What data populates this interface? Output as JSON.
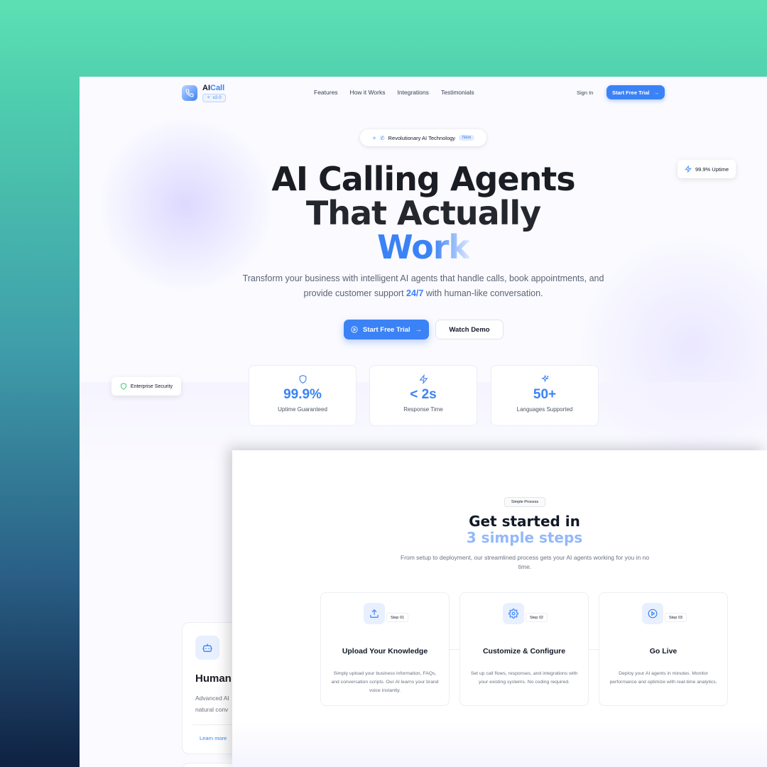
{
  "colors": {
    "accent": "#3b82f6",
    "bg_top": "#5ce0b3",
    "bg_bottom": "#0f2142",
    "text": "#111827"
  },
  "nav": {
    "brand_ai": "AI",
    "brand_call": "Call",
    "version": "v2.0",
    "links": [
      "Features",
      "How it Works",
      "Integrations",
      "Testimonials"
    ],
    "sign_in": "Sign In",
    "cta": "Start Free Trial"
  },
  "hero": {
    "pill_text": "Revolutionary AI Technology",
    "pill_badge": "New",
    "uptime_chip": "99.9% Uptime",
    "title_line1": "AI Calling Agents",
    "title_line2": "That Actually",
    "title_line3": "Work",
    "subtitle_before": "Transform your business with intelligent AI agents that handle calls, book appointments, and provide customer support ",
    "subtitle_highlight": "24/7",
    "subtitle_after": " with human-like conversation.",
    "cta_primary": "Start Free Trial",
    "cta_secondary": "Watch Demo",
    "security_chip": "Enterprise Security",
    "stats": [
      {
        "value": "99.9%",
        "label": "Uptime Guaranteed",
        "icon": "shield-icon"
      },
      {
        "value": "< 2s",
        "label": "Response Time",
        "icon": "zap-icon"
      },
      {
        "value": "50+",
        "label": "Languages Supported",
        "icon": "sparkles-icon"
      }
    ]
  },
  "feature_card": {
    "icon": "bot-icon",
    "title": "Human",
    "desc_line1": "Advanced AI",
    "desc_line2": "natural conv",
    "link": "Learn more"
  },
  "process": {
    "tag": "Simple Process",
    "title_line1": "Get started in",
    "title_line2": "3 simple steps",
    "description": "From setup to deployment, our streamlined process gets your AI agents working for you in no time.",
    "steps": [
      {
        "number": "Step 01",
        "title": "Upload Your Knowledge",
        "description": "Simply upload your business information, FAQs, and conversation scripts. Our AI learns your brand voice instantly.",
        "icon": "upload-icon"
      },
      {
        "number": "Step 02",
        "title": "Customize & Configure",
        "description": "Set up call flows, responses, and integrations with your existing systems. No coding required.",
        "icon": "gear-icon"
      },
      {
        "number": "Step 03",
        "title": "Go Live",
        "description": "Deploy your AI agents in minutes. Monitor performance and optimize with real-time analytics.",
        "icon": "play-icon"
      }
    ]
  }
}
